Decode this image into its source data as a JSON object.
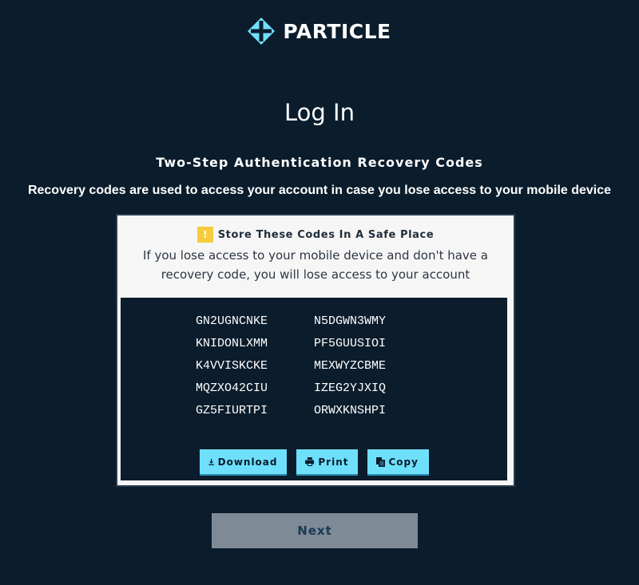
{
  "brand": {
    "name": "PARTICLE",
    "logo_icon": "particle-logo-icon",
    "accent_color": "#6ee0fb"
  },
  "page": {
    "title": "Log In",
    "subtitle": "Two-Step Authentication Recovery Codes",
    "description": "Recovery codes are used to access your account in case you lose access to your mobile device"
  },
  "warning": {
    "icon": "exclamation-icon",
    "icon_glyph": "!",
    "icon_color": "#f5cc3d",
    "title": "Store These Codes In A Safe Place",
    "text": "If you lose access to your mobile device and don't have a recovery code, you will lose access to your account"
  },
  "codes": [
    "GN2UGNCNKE",
    "N5DGWN3WMY",
    "KNIDONLXMM",
    "PF5GUUSIOI",
    "K4VVISKCKE",
    "MEXWYZCBME",
    "MQZXO42CIU",
    "IZEG2YJXIQ",
    "GZ5FIURTPI",
    "ORWXKNSHPI"
  ],
  "actions": {
    "download_label": "Download",
    "print_label": "Print",
    "copy_label": "Copy"
  },
  "footer": {
    "next_label": "Next"
  }
}
